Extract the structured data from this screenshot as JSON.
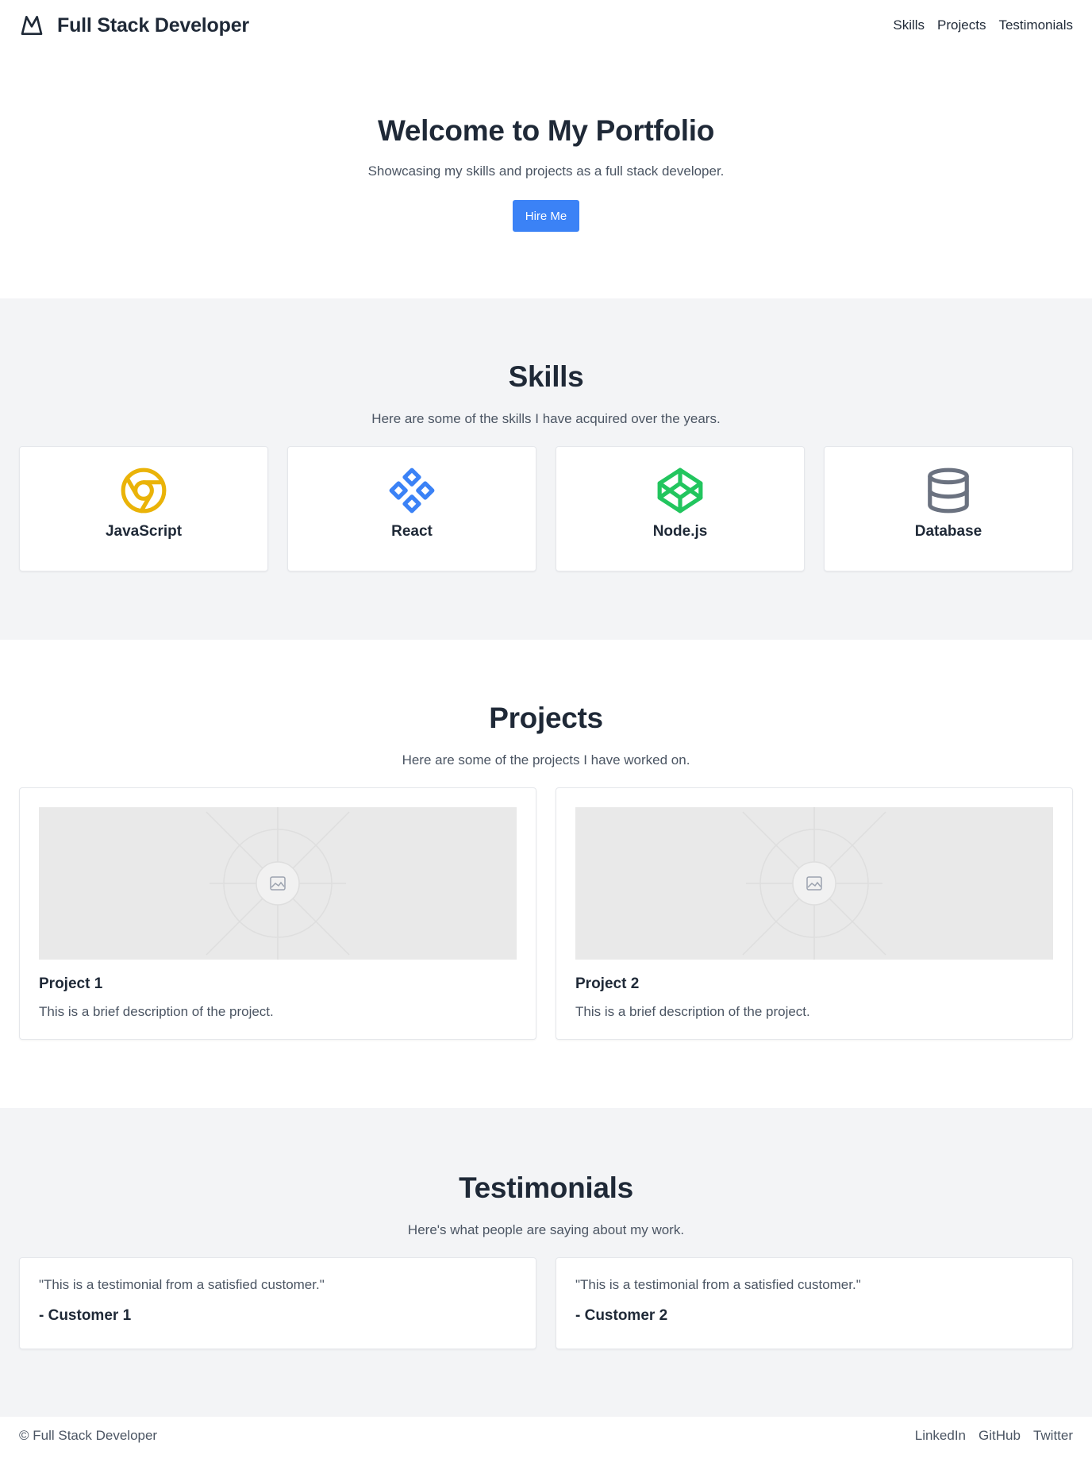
{
  "header": {
    "brand": "Full Stack Developer",
    "logo_icon": "mountain-icon",
    "nav": [
      {
        "label": "Skills"
      },
      {
        "label": "Projects"
      },
      {
        "label": "Testimonials"
      }
    ]
  },
  "hero": {
    "title": "Welcome to My Portfolio",
    "subtitle": "Showcasing my skills and projects as a full stack developer.",
    "cta_label": "Hire Me"
  },
  "skills": {
    "title": "Skills",
    "lead": "Here are some of the skills I have acquired over the years.",
    "items": [
      {
        "name": "JavaScript",
        "icon": "chrome-icon",
        "color": "#eab308"
      },
      {
        "name": "React",
        "icon": "component-icon",
        "color": "#3b82f6"
      },
      {
        "name": "Node.js",
        "icon": "codepen-icon",
        "color": "#22c55e"
      },
      {
        "name": "Database",
        "icon": "database-icon",
        "color": "#6b7280"
      }
    ]
  },
  "projects": {
    "title": "Projects",
    "lead": "Here are some of the projects I have worked on.",
    "items": [
      {
        "title": "Project 1",
        "description": "This is a brief description of the project.",
        "image_icon": "image-placeholder-icon"
      },
      {
        "title": "Project 2",
        "description": "This is a brief description of the project.",
        "image_icon": "image-placeholder-icon"
      }
    ]
  },
  "testimonials": {
    "title": "Testimonials",
    "lead": "Here's what people are saying about my work.",
    "items": [
      {
        "quote": "\"This is a testimonial from a satisfied customer.\"",
        "author": "- Customer 1"
      },
      {
        "quote": "\"This is a testimonial from a satisfied customer.\"",
        "author": "- Customer 2"
      }
    ]
  },
  "footer": {
    "copyright": "© Full Stack Developer",
    "links": [
      {
        "label": "LinkedIn"
      },
      {
        "label": "GitHub"
      },
      {
        "label": "Twitter"
      }
    ]
  },
  "colors": {
    "accent": "#3b82f6",
    "text": "#1f2937",
    "muted": "#4b5563",
    "section_bg": "#f3f4f6"
  }
}
